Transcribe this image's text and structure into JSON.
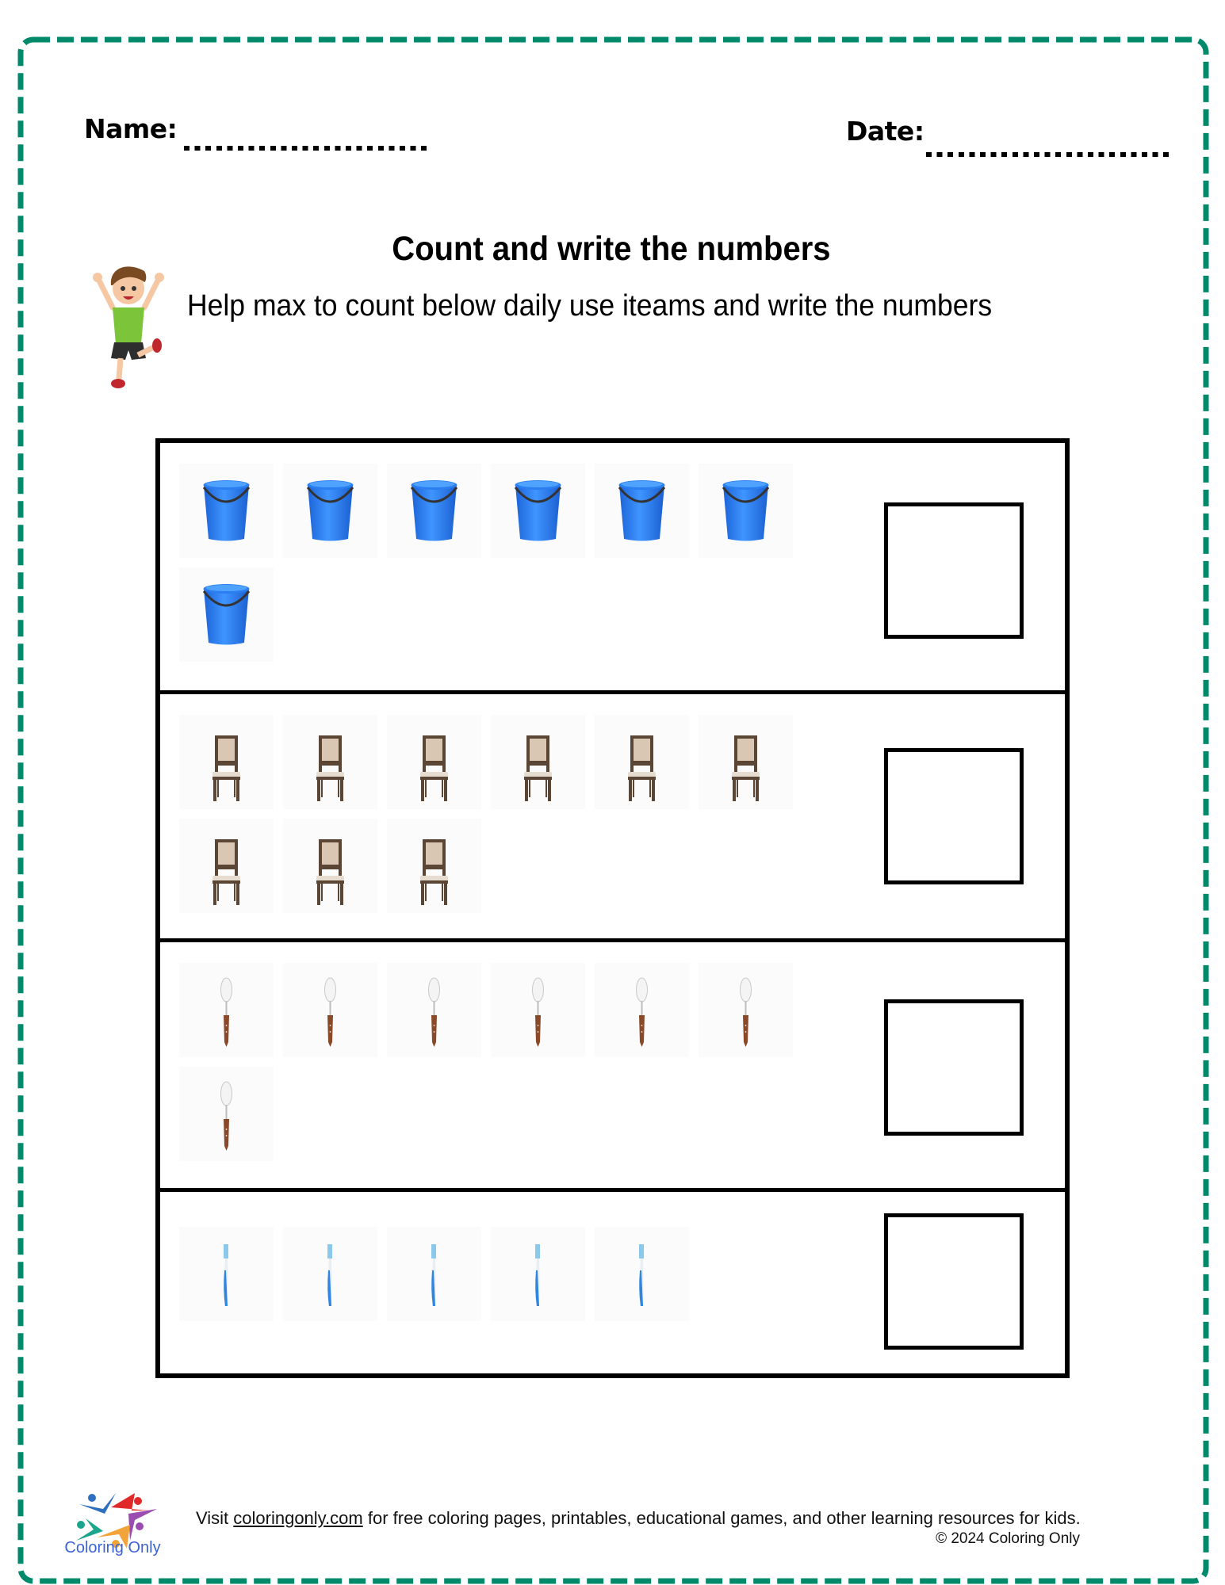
{
  "header": {
    "name_label": "Name:",
    "date_label": "Date:"
  },
  "title": "Count and write the numbers",
  "instructions": "Help max to count below daily use iteams and write the numbers",
  "mascot_icon": "cartoon-boy-jumping",
  "theme": {
    "border_color": "#00896A",
    "logo_text_color": "#3b63d3"
  },
  "rows": [
    {
      "item": "bucket",
      "icon": "bucket-icon",
      "count": 7,
      "answer": ""
    },
    {
      "item": "chair",
      "icon": "chair-icon",
      "count": 9,
      "answer": ""
    },
    {
      "item": "spoon",
      "icon": "spoon-icon",
      "count": 7,
      "answer": ""
    },
    {
      "item": "toothbrush",
      "icon": "toothbrush-icon",
      "count": 5,
      "answer": ""
    }
  ],
  "footer": {
    "logo_text": "Coloring Only",
    "visit_prefix": "Visit ",
    "link_text": "coloringonly.com",
    "visit_suffix": " for free coloring pages, printables, educational games, and other learning resources for kids.",
    "copyright": "© 2024 Coloring Only"
  }
}
